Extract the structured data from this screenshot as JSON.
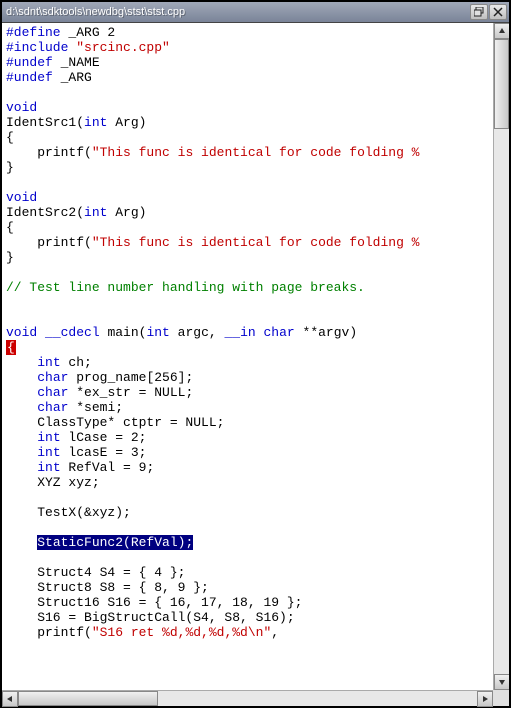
{
  "window": {
    "title": "d:\\sdnt\\sdktools\\newdbg\\stst\\stst.cpp"
  },
  "code": {
    "l1_define": "#define",
    "l1_rest": " _ARG 2",
    "l2_include": "#include",
    "l2_str": " \"srcinc.cpp\"",
    "l3_undef": "#undef",
    "l3_rest": " _NAME",
    "l4_undef": "#undef",
    "l4_rest": " _ARG",
    "blank": "",
    "l6_void": "void",
    "l7": "IdentSrc1(",
    "l7_int": "int",
    "l7_rest": " Arg)",
    "l8": "{",
    "l9_a": "    printf(",
    "l9_str": "\"This func is identical for code folding %",
    "l10": "}",
    "l12_void": "void",
    "l13": "IdentSrc2(",
    "l13_int": "int",
    "l13_rest": " Arg)",
    "l14": "{",
    "l15_a": "    printf(",
    "l15_str": "\"This func is identical for code folding %",
    "l16": "}",
    "l18_comment": "// Test line number handling with page breaks.",
    "l21_void": "void",
    "l21_cdecl": " __cdecl",
    "l21_main": " main(",
    "l21_int1": "int",
    "l21_argc": " argc, ",
    "l21_in": "__in",
    "l21_sp": " ",
    "l21_char": "char",
    "l21_argv": " **argv)",
    "l22_brace": "{",
    "l23_a": "    ",
    "l23_int": "int",
    "l23_b": " ch;",
    "l24_a": "    ",
    "l24_char": "char",
    "l24_b": " prog_name[256];",
    "l25_a": "    ",
    "l25_char": "char",
    "l25_b": " *ex_str = NULL;",
    "l26_a": "    ",
    "l26_char": "char",
    "l26_b": " *semi;",
    "l27": "    ClassType* ctptr = NULL;",
    "l28_a": "    ",
    "l28_int": "int",
    "l28_b": " lCase = 2;",
    "l29_a": "    ",
    "l29_int": "int",
    "l29_b": " lcasE = 3;",
    "l30_a": "    ",
    "l30_int": "int",
    "l30_b": " RefVal = 9;",
    "l31": "    XYZ xyz;",
    "l33": "    TestX(&xyz);",
    "l35_a": "    ",
    "l35_sel": "StaticFunc2(RefVal);",
    "l37": "    Struct4 S4 = { 4 };",
    "l38": "    Struct8 S8 = { 8, 9 };",
    "l39": "    Struct16 S16 = { 16, 17, 18, 19 };",
    "l40": "    S16 = BigStructCall(S4, S8, S16);",
    "l41_a": "    printf(",
    "l41_str": "\"S16 ret %d,%d,%d,%d\\n\"",
    "l41_b": ","
  }
}
